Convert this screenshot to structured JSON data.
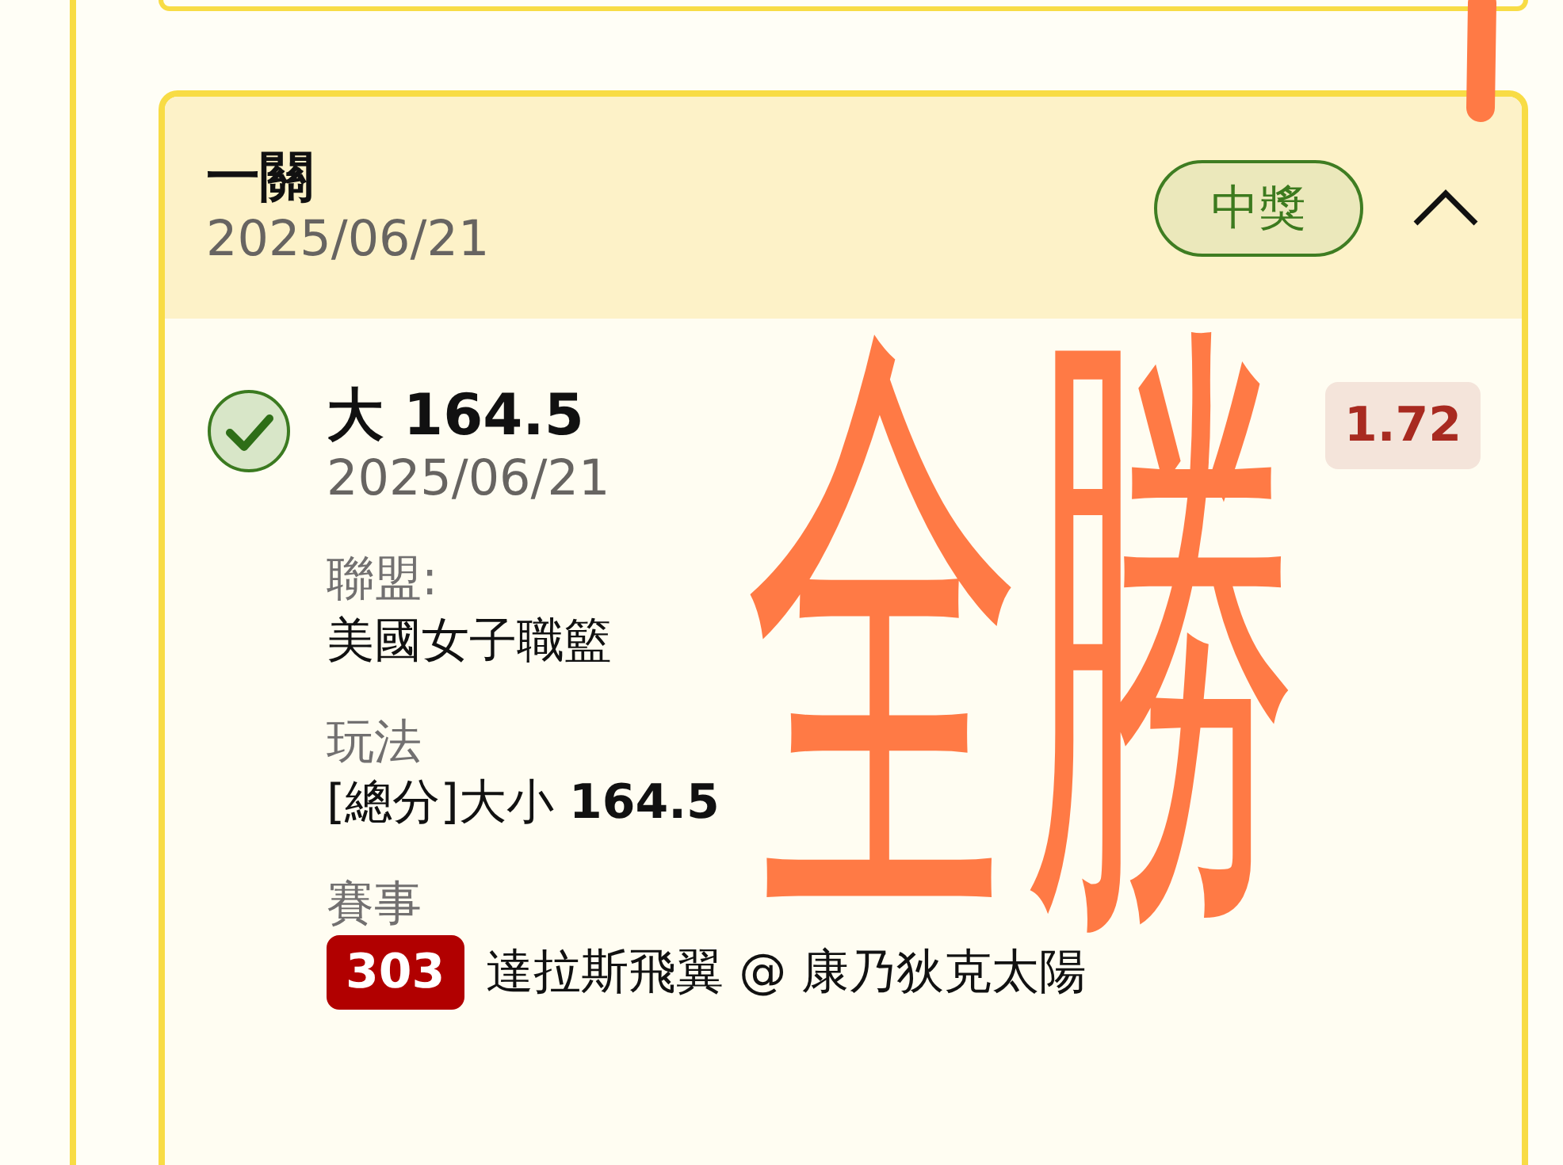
{
  "ticket": {
    "title": "一關",
    "date": "2025/06/21",
    "status": "中獎",
    "expanded": true,
    "bets": [
      {
        "won": true,
        "selection": "大 164.5",
        "date": "2025/06/21",
        "odds": "1.72",
        "fields": [
          {
            "label": "聯盟:",
            "value": "美國女子職籃"
          },
          {
            "label": "玩法",
            "value": "[總分]大小 **164.5**"
          },
          {
            "label": "賽事",
            "code": "303",
            "value": "達拉斯飛翼 @ 康乃狄克太陽"
          }
        ]
      }
    ]
  },
  "annotation": {
    "text": "全勝"
  }
}
